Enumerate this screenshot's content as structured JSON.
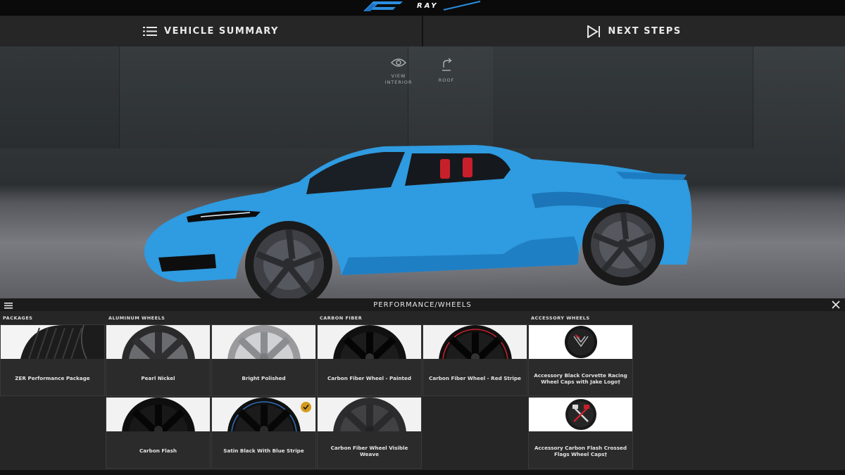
{
  "logo": {
    "text": "E-RAY"
  },
  "header": {
    "tabs": [
      {
        "label": "VEHICLE SUMMARY",
        "icon": "list-icon"
      },
      {
        "label": "NEXT STEPS",
        "icon": "play-icon"
      }
    ]
  },
  "stage": {
    "view_interior": {
      "label": "VIEW INTERIOR",
      "icon": "eye-icon"
    },
    "roof": {
      "label": "ROOF",
      "icon": "roof-icon"
    },
    "car_color": "#2f9be0"
  },
  "panel": {
    "title": "PERFORMANCE/WHEELS",
    "categories": {
      "packages": "PACKAGES",
      "aluminum": "ALUMINUM WHEELS",
      "carbon": "CARBON FIBER",
      "accessory": "ACCESSORY WHEELS"
    },
    "options": {
      "zer": "ZER Performance Package",
      "pearl_nickel": "Pearl Nickel",
      "bright_polished": "Bright Polished",
      "cf_painted": "Carbon Fiber Wheel - Painted",
      "cf_red": "Carbon Fiber Wheel - Red Stripe",
      "acc_black_caps": "Accessory Black Corvette Racing Wheel Caps with Jake Logo†",
      "carbon_flash": "Carbon Flash",
      "satin_blue": "Satin Black With Blue Stripe",
      "cf_visible": "Carbon Fiber Wheel Visible Weave",
      "acc_flags_caps": "Accessory Carbon Flash Crossed Flags Wheel Caps†"
    },
    "selected": "satin_blue",
    "accent": "#d49a1c"
  }
}
